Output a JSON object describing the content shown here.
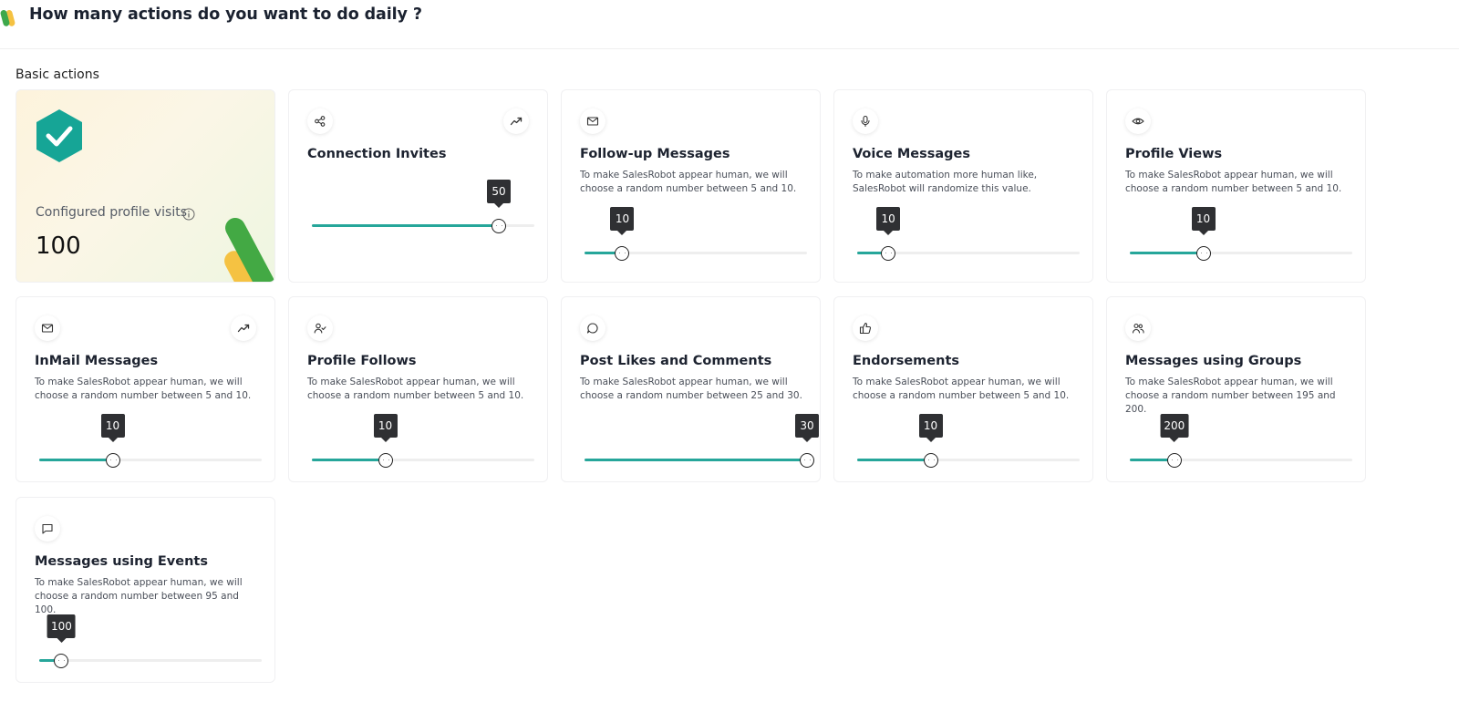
{
  "header": {
    "title": "How many actions do you want to do daily ?"
  },
  "section": {
    "label": "Basic actions"
  },
  "profile_visits": {
    "label": "Configured profile visits",
    "value": "100"
  },
  "colors": {
    "accent": "#26a69a",
    "tooltip": "#2f3033",
    "shield": "#16a596"
  },
  "cards": [
    {
      "title": "Connection Invites",
      "icon": "share-icon",
      "trend": true,
      "desc": "",
      "value": "50",
      "percent": 84
    },
    {
      "title": "Follow-up Messages",
      "icon": "mail-icon",
      "trend": false,
      "desc": "To make SalesRobot appear human, we will choose a random number between 5 and 10.",
      "value": "10",
      "percent": 17
    },
    {
      "title": "Voice Messages",
      "icon": "microphone-icon",
      "trend": false,
      "desc": "To make automation more human like, SalesRobot will randomize this value.",
      "value": "10",
      "percent": 14
    },
    {
      "title": "Profile Views",
      "icon": "eye-icon",
      "trend": false,
      "desc": "To make SalesRobot appear human, we will choose a random number between 5 and 10.",
      "value": "10",
      "percent": 33
    },
    {
      "title": "InMail Messages",
      "icon": "mail-icon",
      "trend": true,
      "desc": "To make SalesRobot appear human, we will choose a random number between 5 and 10.",
      "value": "10",
      "percent": 33
    },
    {
      "title": "Profile Follows",
      "icon": "user-check-icon",
      "trend": false,
      "desc": "To make SalesRobot appear human, we will choose a random number between 5 and 10.",
      "value": "10",
      "percent": 33
    },
    {
      "title": "Post Likes and Comments",
      "icon": "comment-icon",
      "trend": false,
      "desc": "To make SalesRobot appear human, we will choose a random number between 25 and 30.",
      "value": "30",
      "percent": 100
    },
    {
      "title": "Endorsements",
      "icon": "thumbs-up-icon",
      "trend": false,
      "desc": "To make SalesRobot appear human, we will choose a random number between 5 and 10.",
      "value": "10",
      "percent": 33
    },
    {
      "title": "Messages using Groups",
      "icon": "users-icon",
      "trend": false,
      "desc": "To make SalesRobot appear human, we will choose a random number between 195 and 200.",
      "value": "200",
      "percent": 20
    },
    {
      "title": "Messages using Events",
      "icon": "message-square-icon",
      "trend": false,
      "desc": "To make SalesRobot appear human, we will choose a random number between 95 and 100.",
      "value": "100",
      "percent": 10
    }
  ]
}
